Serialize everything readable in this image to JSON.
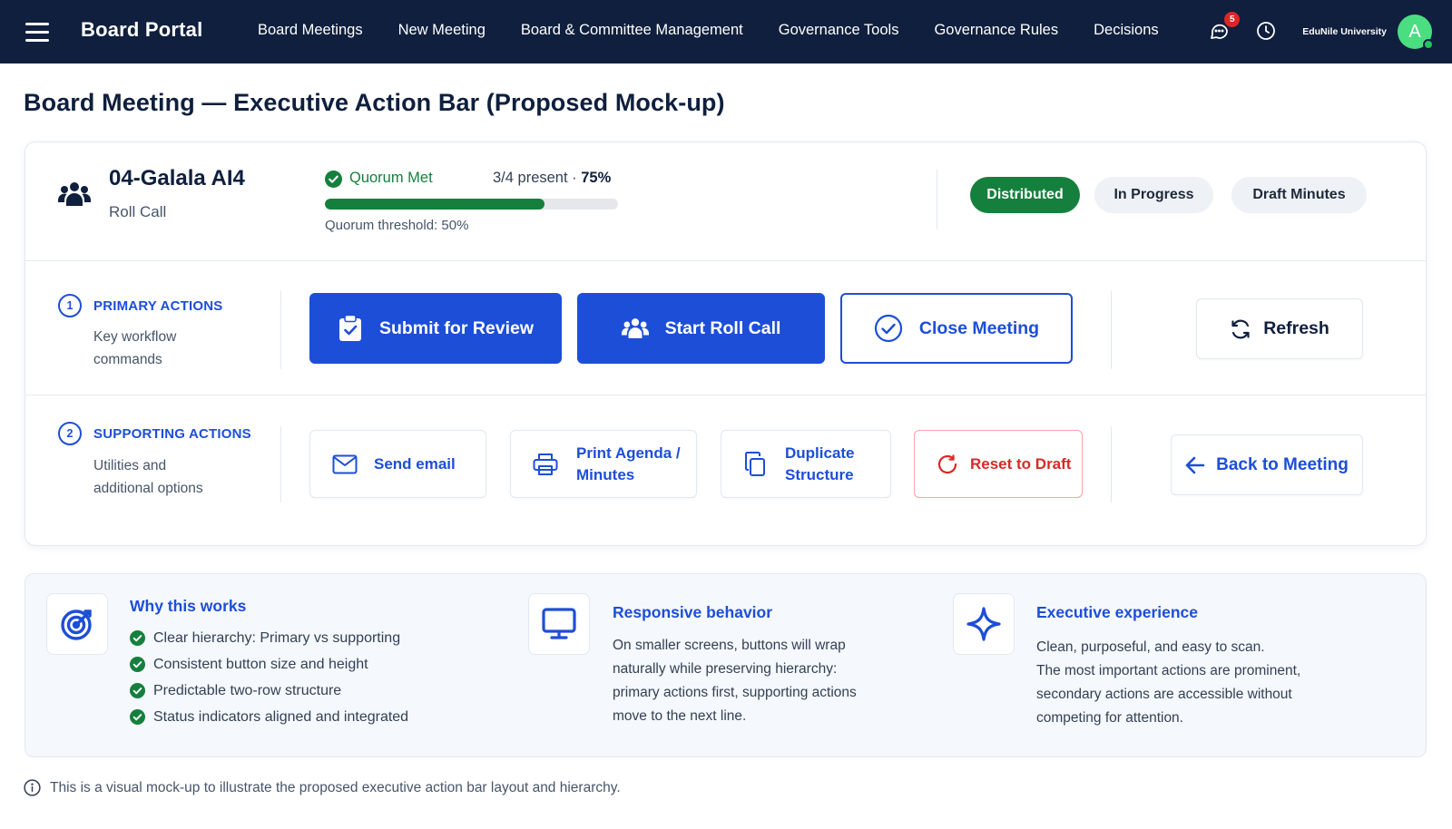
{
  "nav": {
    "brand": "Board Portal",
    "links": [
      "Board Meetings",
      "New Meeting",
      "Board & Committee Management",
      "Governance Tools",
      "Governance Rules",
      "Decisions"
    ],
    "notifications_count": "5",
    "org_name": "EduNile University",
    "avatar_initial": "A"
  },
  "page": {
    "title": "Board Meeting — Executive Action Bar (Proposed Mock-up)"
  },
  "meeting": {
    "name": "04-Galala AI4",
    "subtitle": "Roll Call"
  },
  "quorum": {
    "label": "Quorum Met",
    "present_text": "3/4 present ·",
    "percent_text": "75%",
    "progress_fraction": 0.75,
    "threshold_text": "Quorum threshold: 50%"
  },
  "status_pills": {
    "distributed": "Distributed",
    "in_progress": "In Progress",
    "draft_minutes": "Draft Minutes"
  },
  "primary_section": {
    "number": "1",
    "title": "PRIMARY ACTIONS",
    "desc_line1": "Key workflow",
    "desc_line2": "commands",
    "submit_label": "Submit for Review",
    "roll_call_label": "Start Roll Call",
    "close_label": "Close Meeting",
    "refresh_label": "Refresh"
  },
  "supporting_section": {
    "number": "2",
    "title": "SUPPORTING ACTIONS",
    "desc_line1": "Utilities and",
    "desc_line2": "additional options",
    "send_email_label": "Send email",
    "print_line1": "Print Agenda /",
    "print_line2": "Minutes",
    "duplicate_line1": "Duplicate",
    "duplicate_line2": "Structure",
    "reset_label": "Reset to Draft",
    "back_label": "Back to Meeting"
  },
  "info": {
    "why_title": "Why this works",
    "why_items": [
      "Clear hierarchy: Primary vs supporting",
      "Consistent button size and height",
      "Predictable two-row structure",
      "Status indicators aligned and integrated"
    ],
    "responsive_title": "Responsive behavior",
    "responsive_lines": [
      "On smaller screens, buttons will wrap",
      "naturally while preserving hierarchy:",
      "primary actions first, supporting actions",
      "move to the next line."
    ],
    "executive_title": "Executive experience",
    "executive_lines": [
      "Clean, purposeful, and easy to scan.",
      "The most important actions are prominent,",
      "secondary actions are accessible without",
      "competing for attention."
    ]
  },
  "footnote": "This is a visual mock-up to illustrate the proposed executive action bar layout and hierarchy.",
  "colors": {
    "nav_bg": "#0f1f3d",
    "primary_blue": "#1d4ed8",
    "success_green": "#15803d",
    "danger_red": "#dc2626"
  }
}
